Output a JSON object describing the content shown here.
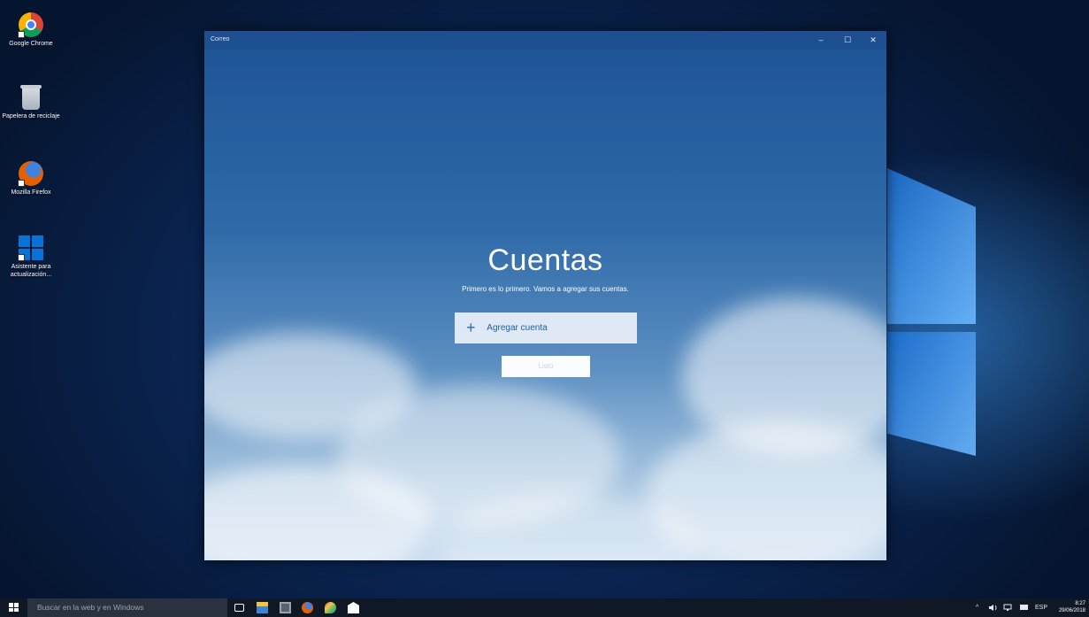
{
  "desktop": {
    "icons": [
      {
        "label": "Google Chrome",
        "icon": "chrome-icon"
      },
      {
        "label": "Papelera de reciclaje",
        "icon": "recycle-bin-icon"
      },
      {
        "label": "Mozilla Firefox",
        "icon": "firefox-icon"
      },
      {
        "label": "Asistente para actualización...",
        "icon": "windows-update-assistant-icon"
      }
    ]
  },
  "window": {
    "title": "Correo",
    "minimize_glyph": "–",
    "maximize_glyph": "☐",
    "close_glyph": "✕"
  },
  "accounts": {
    "title": "Cuentas",
    "subtitle": "Primero es lo primero. Vamos a agregar sus cuentas.",
    "add_button_icon": "+",
    "add_button_label": "Agregar cuenta",
    "done_button_label": "Listo"
  },
  "taskbar": {
    "search_placeholder": "Buscar en la web y en Windows",
    "pinned": [
      "task-view-icon",
      "file-explorer-icon",
      "store-icon",
      "firefox-icon",
      "paint-icon",
      "mail-icon"
    ],
    "tray": {
      "chevron": "^",
      "language": "ESP",
      "time": "8:27",
      "date": "29/06/2018"
    }
  }
}
